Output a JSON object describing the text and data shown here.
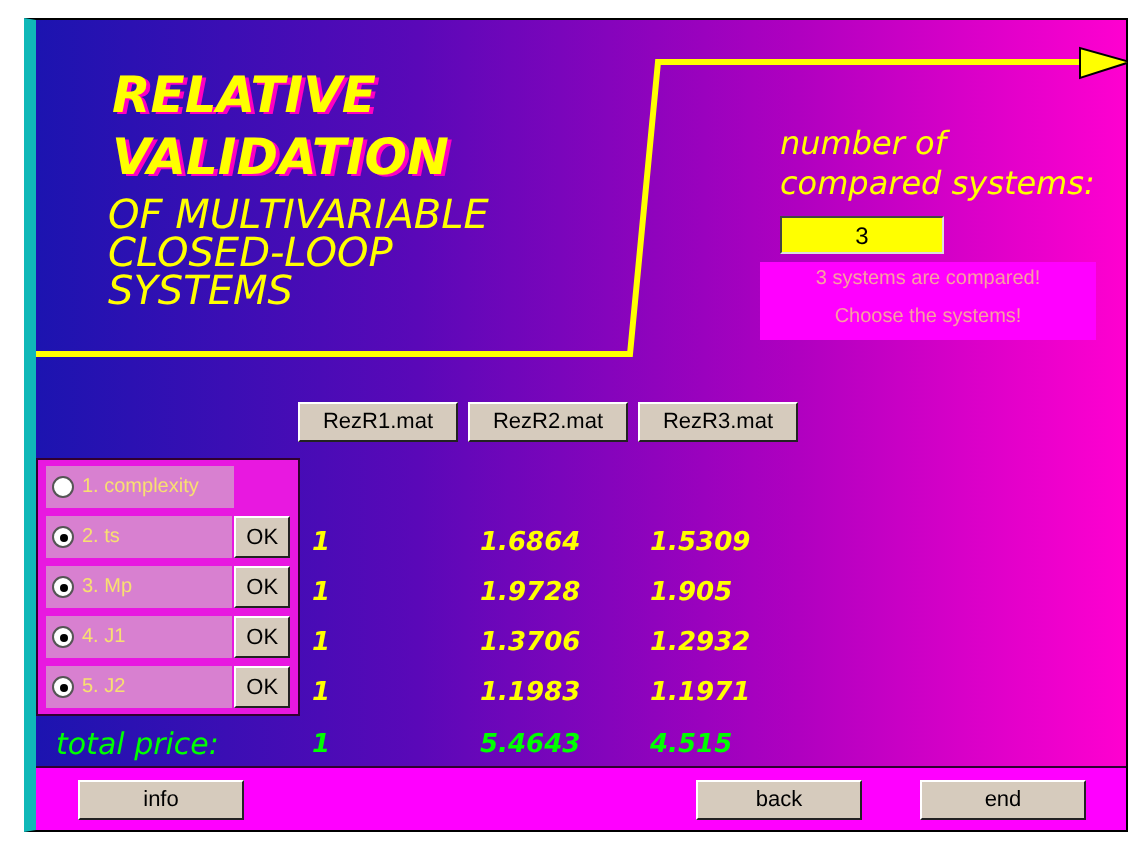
{
  "title_lines": [
    "RELATIVE",
    "VALIDATION"
  ],
  "subtitle_lines": [
    "OF MULTIVARIABLE",
    "CLOSED-LOOP",
    "SYSTEMS"
  ],
  "systems_count": {
    "label_lines": [
      "number of",
      "compared systems:"
    ],
    "value": "3",
    "messages": [
      "3 systems are compared!",
      "Choose the systems!"
    ]
  },
  "files": [
    "RezR1.mat",
    "RezR2.mat",
    "RezR3.mat"
  ],
  "criteria": [
    {
      "label": "1. complexity",
      "checked": false
    },
    {
      "label": "2. ts",
      "checked": true,
      "button": "OK",
      "values": [
        "1",
        "1.6864",
        "1.5309"
      ]
    },
    {
      "label": "3. Mp",
      "checked": true,
      "button": "OK",
      "values": [
        "1",
        "1.9728",
        "1.905"
      ]
    },
    {
      "label": "4. J1",
      "checked": true,
      "button": "OK",
      "values": [
        "1",
        "1.3706",
        "1.2932"
      ]
    },
    {
      "label": "5. J2",
      "checked": true,
      "button": "OK",
      "values": [
        "1",
        "1.1983",
        "1.1971"
      ]
    }
  ],
  "total": {
    "label": "total price:",
    "values": [
      "1",
      "5.4643",
      "4.515"
    ]
  },
  "buttons": [
    "info",
    "back",
    "end"
  ]
}
